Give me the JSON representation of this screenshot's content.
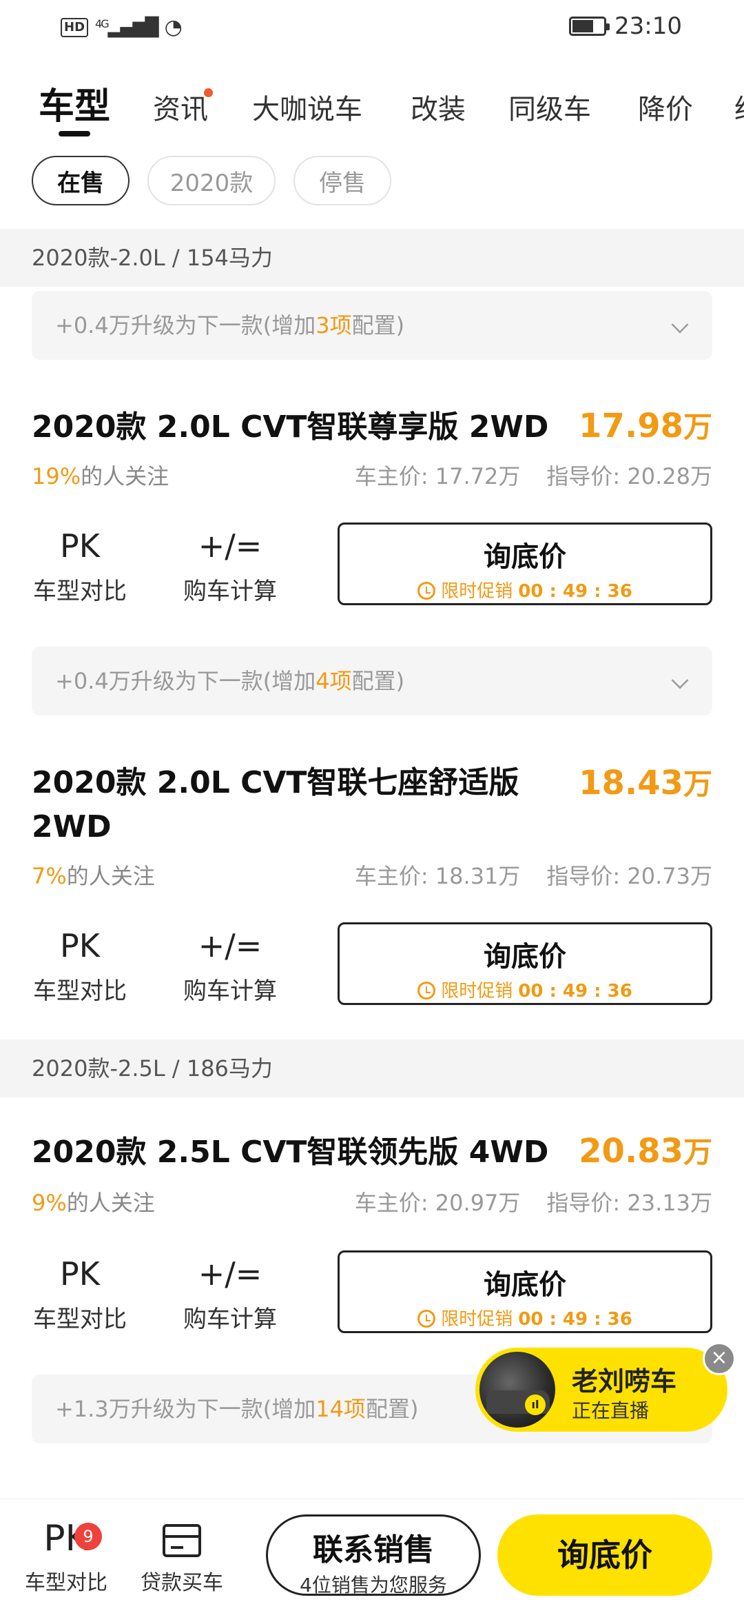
{
  "status_bar": {
    "network": "HD",
    "signal": "4G",
    "time": "23:10"
  },
  "tabs": [
    {
      "label": "车型",
      "active": true
    },
    {
      "label": "资讯",
      "dot": true
    },
    {
      "label": "大咖说车"
    },
    {
      "label": "改装"
    },
    {
      "label": "同级车"
    },
    {
      "label": "降价"
    },
    {
      "label": "经"
    }
  ],
  "filters": [
    {
      "label": "在售",
      "active": true
    },
    {
      "label": "2020款"
    },
    {
      "label": "停售"
    }
  ],
  "sections": [
    {
      "header": "2020款-2.0L / 154马力"
    },
    {
      "header": "2020款-2.5L / 186马力"
    }
  ],
  "upgrades": [
    {
      "prefix": "+0.4万升级为下一款(增加",
      "count": "3项",
      "suffix": "配置)"
    },
    {
      "prefix": "+0.4万升级为下一款(增加",
      "count": "4项",
      "suffix": "配置)"
    },
    {
      "prefix": "+1.3万升级为下一款(增加",
      "count": "14项",
      "suffix": "配置)"
    }
  ],
  "cards": [
    {
      "title": "2020款 2.0L CVT智联尊享版 2WD",
      "price": "17.98",
      "price_unit": "万",
      "attention_pct": "19%",
      "attention_text": "的人关注",
      "owner_price": "车主价: 17.72万",
      "guide_price": "指导价: 20.28万"
    },
    {
      "title": "2020款 2.0L CVT智联七座舒适版 2WD",
      "price": "18.43",
      "price_unit": "万",
      "attention_pct": "7%",
      "attention_text": "的人关注",
      "owner_price": "车主价: 18.31万",
      "guide_price": "指导价: 20.73万"
    },
    {
      "title": "2020款 2.5L CVT智联领先版 4WD",
      "price": "20.83",
      "price_unit": "万",
      "attention_pct": "9%",
      "attention_text": "的人关注",
      "owner_price": "车主价: 20.97万",
      "guide_price": "指导价: 23.13万"
    }
  ],
  "card_tools": {
    "compare_icon": "PK",
    "compare_label": "车型对比",
    "calc_icon": "+/=",
    "calc_label": "购车计算",
    "ask_title": "询底价",
    "promo_label": "限时促销",
    "promo_timer": "00 : 49 : 36"
  },
  "live": {
    "name": "老刘唠车",
    "status": "正在直播",
    "close": "×"
  },
  "bottom_bar": {
    "compare_icon": "PK",
    "compare_badge": "9",
    "compare_label": "车型对比",
    "loan_label": "贷款买车",
    "contact_title": "联系销售",
    "contact_sub": "4位销售为您服务",
    "ask_label": "询底价"
  },
  "colors": {
    "accent": "#f29a14",
    "brand_yellow": "#ffe100",
    "badge_red": "#f0413b",
    "dot": "#f25a2b"
  }
}
